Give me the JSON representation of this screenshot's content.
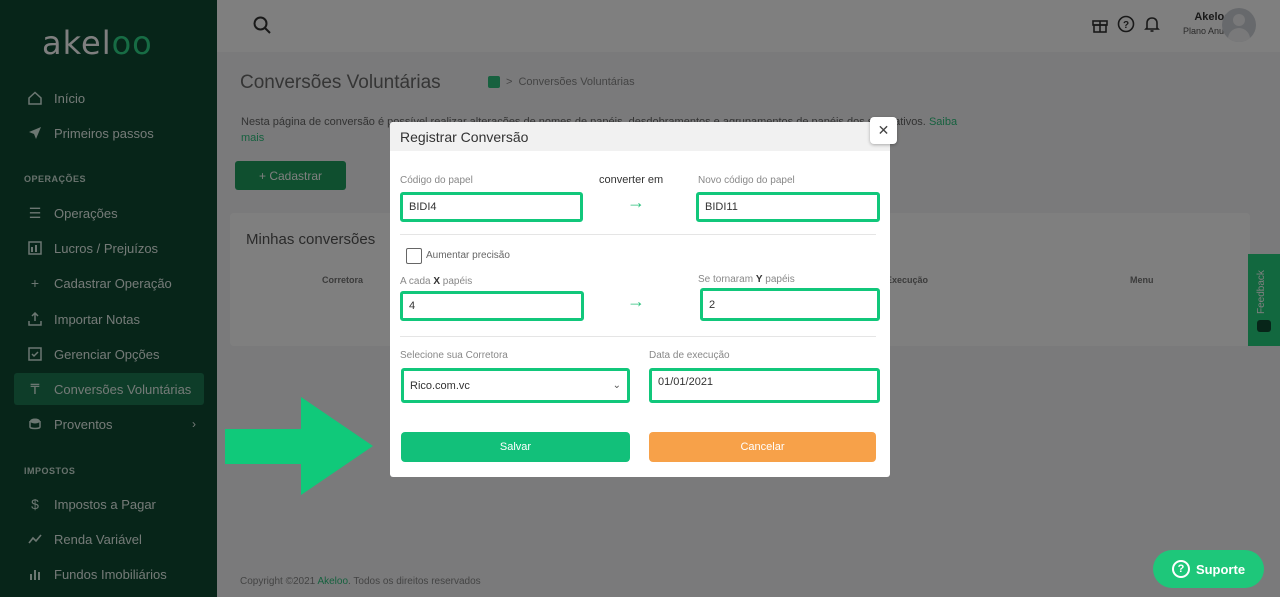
{
  "app": {
    "logo_prefix": "akel",
    "logo_suffix": "oo"
  },
  "sidebar": {
    "items_top": [
      {
        "label": "Início",
        "icon": "home-icon"
      },
      {
        "label": "Primeiros passos",
        "icon": "paper-plane-icon"
      }
    ],
    "section_operacoes": "OPERAÇÕES",
    "items_operacoes": [
      {
        "label": "Operações",
        "icon": "list-icon"
      },
      {
        "label": "Lucros / Prejuízos",
        "icon": "chart-icon"
      },
      {
        "label": "Cadastrar Operação",
        "icon": "plus-icon"
      },
      {
        "label": "Importar Notas",
        "icon": "upload-icon"
      },
      {
        "label": "Gerenciar Opções",
        "icon": "check-square-icon"
      },
      {
        "label": "Conversões Voluntárias",
        "icon": "conversion-icon",
        "active": true
      },
      {
        "label": "Proventos",
        "icon": "coins-icon",
        "has_chevron": true
      }
    ],
    "section_impostos": "IMPOSTOS",
    "items_impostos": [
      {
        "label": "Impostos a Pagar",
        "icon": "dollar-icon"
      },
      {
        "label": "Renda Variável",
        "icon": "trend-icon"
      },
      {
        "label": "Fundos Imobiliários",
        "icon": "bar-icon"
      }
    ]
  },
  "topbar": {
    "user_name": "Akeloo",
    "user_plan": "Plano Anual"
  },
  "page": {
    "title": "Conversões Voluntárias",
    "breadcrumb": "Conversões Voluntárias",
    "description": "Nesta página de conversão é possível realizar alterações de nomes de papéis, desdobramentos e agrupamentos de papéis dos seus ativos.",
    "learn_more": "Saiba mais",
    "add_button": "+ Cadastrar",
    "card_title": "Minhas conversões",
    "table_headers": [
      "Corretora",
      "Execução",
      "Menu"
    ]
  },
  "footer": {
    "text": "Copyright ©2021",
    "brand": "Akeloo",
    "rest": ". Todos os direitos reservados"
  },
  "feedback": "Feedback",
  "support_button": "Suporte",
  "modal": {
    "title": "Registrar Conversão",
    "codigo_label": "Código do papel",
    "codigo_value": "BIDI4",
    "converter_label": "converter em",
    "novo_codigo_label": "Novo código do papel",
    "novo_codigo_value": "BIDI11",
    "precisao_label": "Aumentar precisão",
    "cada_x_prefix": "A cada ",
    "cada_x_bold": "X",
    "cada_x_suffix": " papéis",
    "x_value": "4",
    "tornaram_prefix": "Se tornaram ",
    "tornaram_bold": "Y",
    "tornaram_suffix": " papéis",
    "y_value": "2",
    "corretora_label": "Selecione sua Corretora",
    "corretora_value": "Rico.com.vc",
    "data_label": "Data de execução",
    "data_value": "01/01/2021",
    "save_label": "Salvar",
    "cancel_label": "Cancelar"
  },
  "colors": {
    "sidebar_bg": "#0e4a33",
    "accent_green": "#12c07a",
    "cancel_orange": "#f7a149",
    "highlight_border": "#11c77b"
  }
}
